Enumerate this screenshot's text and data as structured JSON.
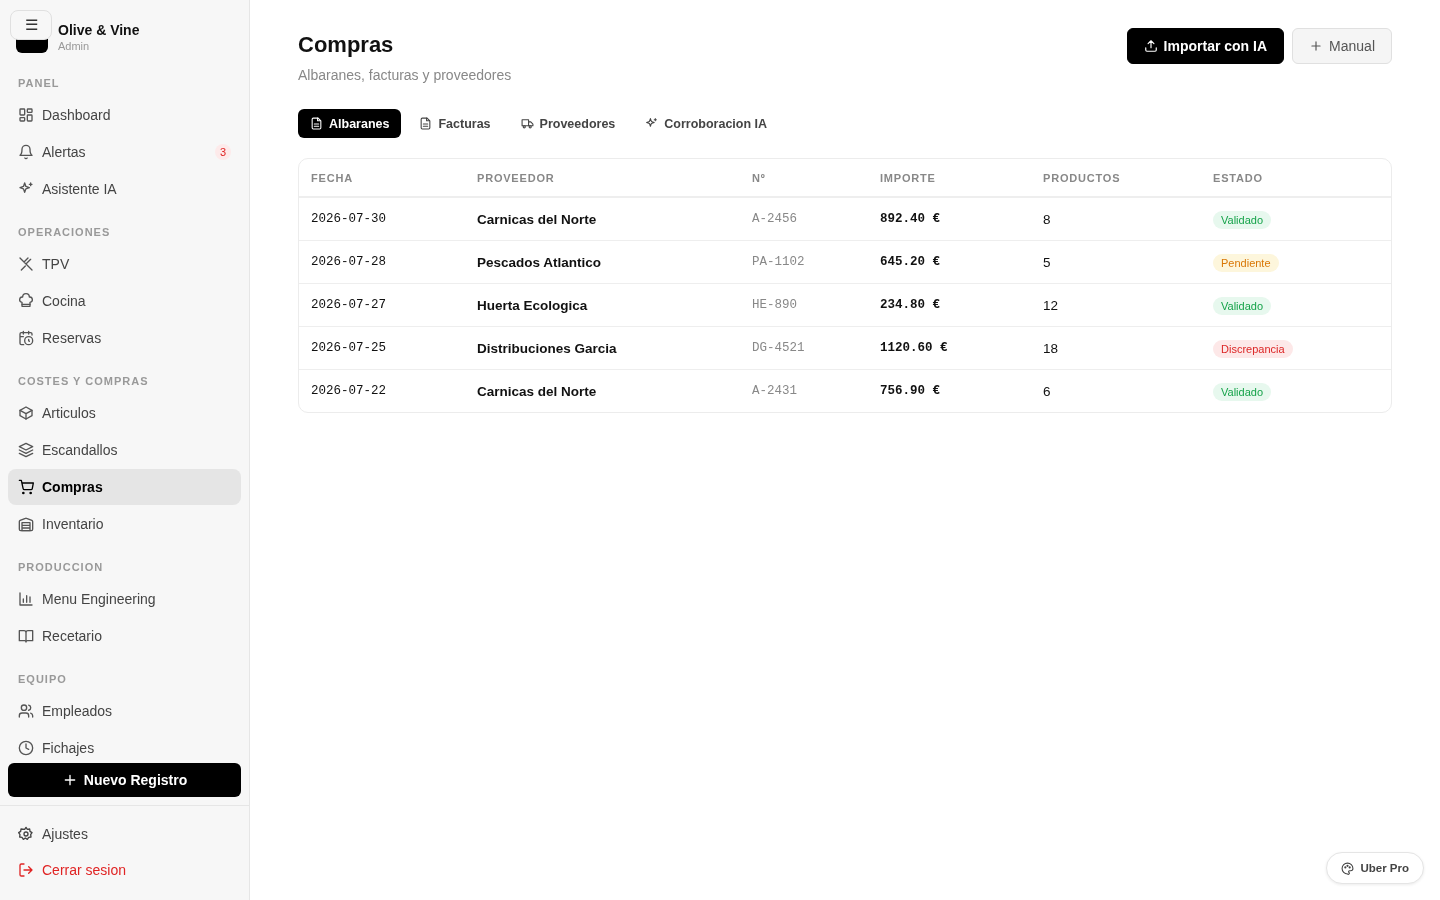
{
  "sidebar": {
    "brand": "Olive & Vine",
    "role": "Admin",
    "menu_button": "☰",
    "sections": [
      {
        "title": "PANEL",
        "items": [
          {
            "label": "Dashboard",
            "selected": false
          },
          {
            "label": "Alertas",
            "selected": false,
            "badge": "3"
          },
          {
            "label": "Asistente IA",
            "selected": false
          }
        ]
      },
      {
        "title": "OPERACIONES",
        "items": [
          {
            "label": "TPV",
            "selected": false
          },
          {
            "label": "Cocina",
            "selected": false
          },
          {
            "label": "Reservas",
            "selected": false
          }
        ]
      },
      {
        "title": "COSTES Y COMPRAS",
        "items": [
          {
            "label": "Articulos",
            "selected": false
          },
          {
            "label": "Escandallos",
            "selected": false
          },
          {
            "label": "Compras",
            "selected": true
          },
          {
            "label": "Inventario",
            "selected": false
          }
        ]
      },
      {
        "title": "PRODUCCION",
        "items": [
          {
            "label": "Menu Engineering",
            "selected": false
          },
          {
            "label": "Recetario",
            "selected": false
          }
        ]
      },
      {
        "title": "EQUIPO",
        "items": [
          {
            "label": "Empleados",
            "selected": false
          },
          {
            "label": "Fichajes",
            "selected": false
          }
        ]
      }
    ],
    "new_button": "Nuevo Registro",
    "footer": [
      {
        "label": "Ajustes",
        "kind": "normal"
      },
      {
        "label": "Cerrar sesion",
        "kind": "danger"
      }
    ]
  },
  "header": {
    "title": "Compras",
    "subtitle": "Albaranes, facturas y proveedores",
    "buttons": [
      {
        "label": "Importar con IA",
        "kind": "primary"
      },
      {
        "label": "Manual",
        "kind": "secondary"
      }
    ]
  },
  "tabs": [
    {
      "label": "Albaranes",
      "selected": true
    },
    {
      "label": "Facturas",
      "selected": false
    },
    {
      "label": "Proveedores",
      "selected": false
    },
    {
      "label": "Corroboracion IA",
      "selected": false
    }
  ],
  "table": {
    "columns": [
      "FECHA",
      "PROVEEDOR",
      "Nº",
      "IMPORTE",
      "PRODUCTOS",
      "ESTADO"
    ],
    "rows": [
      {
        "fecha": "2026-07-30",
        "proveedor": "Carnicas del Norte",
        "numero": "A-2456",
        "importe": "892.40 €",
        "productos": "8",
        "estado": "Validado",
        "kind": "success"
      },
      {
        "fecha": "2026-07-28",
        "proveedor": "Pescados Atlantico",
        "numero": "PA-1102",
        "importe": "645.20 €",
        "productos": "5",
        "estado": "Pendiente",
        "kind": "warning"
      },
      {
        "fecha": "2026-07-27",
        "proveedor": "Huerta Ecologica",
        "numero": "HE-890",
        "importe": "234.80 €",
        "productos": "12",
        "estado": "Validado",
        "kind": "success"
      },
      {
        "fecha": "2026-07-25",
        "proveedor": "Distribuciones Garcia",
        "numero": "DG-4521",
        "importe": "1120.60 €",
        "productos": "18",
        "estado": "Discrepancia",
        "kind": "danger"
      },
      {
        "fecha": "2026-07-22",
        "proveedor": "Carnicas del Norte",
        "numero": "A-2431",
        "importe": "756.90 €",
        "productos": "6",
        "estado": "Validado",
        "kind": "success"
      }
    ]
  },
  "floating_button": "Uber Pro"
}
